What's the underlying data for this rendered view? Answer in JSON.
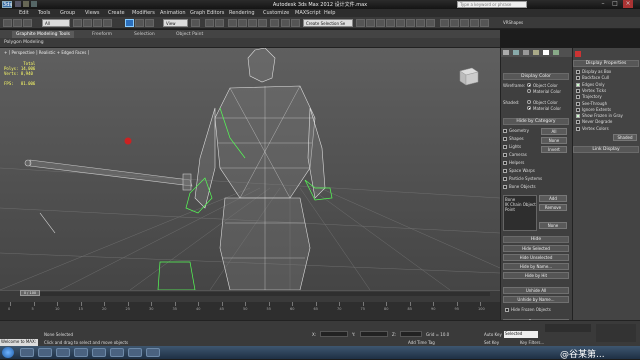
{
  "titlebar": {
    "app_icon": "3ds",
    "title": "Autodesk 3ds Max  2012    设计文件.max",
    "search_placeholder": "Type a keyword or phrase"
  },
  "menubar": {
    "items": [
      "Edit",
      "Tools",
      "Group",
      "Views",
      "Create",
      "Modifiers",
      "Animation",
      "Graph Editors",
      "Rendering",
      "Customize",
      "MAXScript",
      "Help"
    ]
  },
  "toolbar": {
    "selection_filter": "All",
    "reference_coord": "View",
    "named_selection": "Create Selection Se",
    "vray": "VRShapes"
  },
  "ribbon": {
    "tabs": [
      "Graphite Modeling Tools",
      "Freeform",
      "Selection",
      "Object Paint"
    ],
    "sub_label": "Polygon Modeling"
  },
  "viewport": {
    "label": "+ ] Perspective ] Realistic + Edged Faces ]",
    "stats": "        Total\nPolys: 14,006\nVerts: 8,940\n\nFPS:   81.006"
  },
  "display_panel": {
    "display_color": "Display Color",
    "wireframe": "Wireframe:",
    "shaded": "Shaded:",
    "object_color": "Object Color",
    "material_color": "Material Color",
    "hide_by_category": "Hide by Category",
    "categories": [
      "Geometry",
      "Shapes",
      "Lights",
      "Cameras",
      "Helpers",
      "Space Warps",
      "Particle Systems",
      "Bone Objects"
    ],
    "all_btn": "All",
    "none_btn": "None",
    "invert_btn": "Invert",
    "list_items": [
      "Bone",
      "IK Chain Object",
      "Point"
    ],
    "add_btn": "Add",
    "remove_btn": "Remove",
    "none_btn2": "None",
    "hide": "Hide",
    "hide_buttons": [
      "Hide Selected",
      "Hide Unselected",
      "Hide by Name...",
      "Hide by Hit",
      "Unhide All",
      "Unhide by Name...",
      "Hide Frozen Objects"
    ],
    "freeze": "Freeze"
  },
  "props_panel": {
    "title": "Display Properties",
    "items": [
      "Display as Box",
      "Backface Cull",
      "Edges Only",
      "Vertex Ticks",
      "Trajectory",
      "See-Through",
      "Ignore Extents",
      "Show Frozen in Gray",
      "Never Degrade",
      "Vertex Colors"
    ],
    "checked": [
      false,
      false,
      true,
      false,
      false,
      false,
      false,
      true,
      false,
      false
    ],
    "shaded_btn": "Shaded",
    "link_display": "Link Display"
  },
  "timeline": {
    "frame": "0 / 100",
    "ticks": [
      "0",
      "5",
      "10",
      "15",
      "20",
      "25",
      "30",
      "35",
      "40",
      "45",
      "50",
      "55",
      "60",
      "65",
      "70",
      "75",
      "80",
      "85",
      "90",
      "95",
      "100"
    ]
  },
  "status": {
    "welcome": "Welcome to MAX:",
    "selection": "None Selected",
    "prompt": "Click and drag to select and move objects",
    "grid": "Grid = 10.0",
    "auto_key": "Auto Key",
    "selected": "Selected",
    "set_key": "Set Key",
    "key_filters": "Key Filters...",
    "add_time_tag": "Add Time Tag",
    "coords": [
      "X:",
      "Y:",
      "Z:"
    ]
  },
  "watermark": "@谷某第..."
}
